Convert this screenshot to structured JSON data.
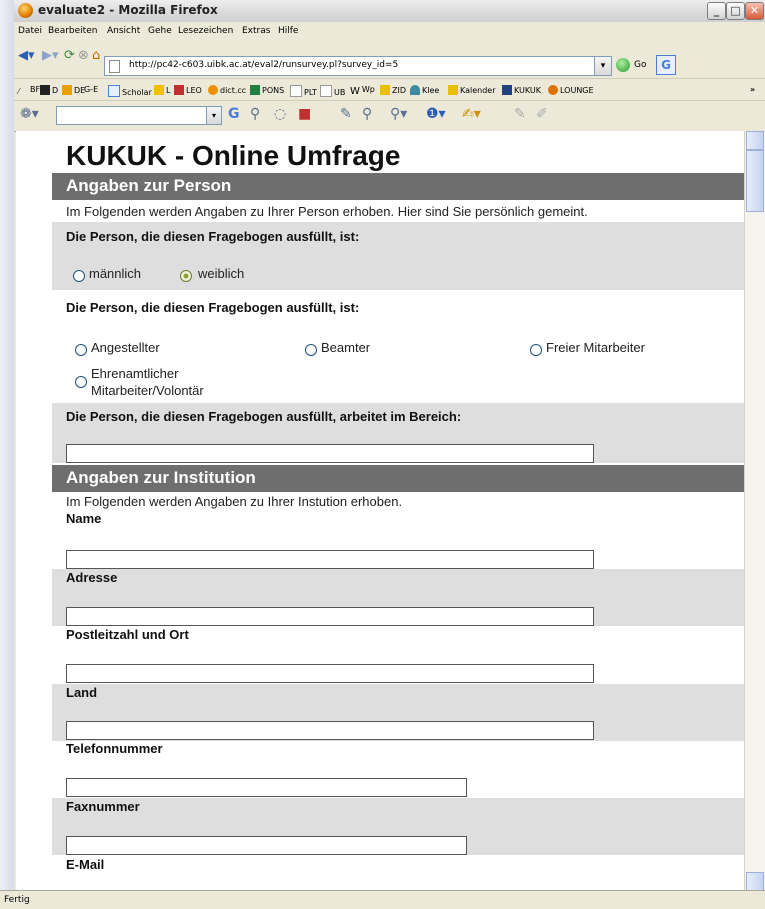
{
  "window": {
    "title": "evaluate2 - Mozilla Firefox"
  },
  "menu": [
    "Datei",
    "Bearbeiten",
    "Ansicht",
    "Gehe",
    "Lesezeichen",
    "Extras",
    "Hilfe"
  ],
  "nav": {
    "url": "http://pc42-c603.uibk.ac.at/eval2/runsurvey.pl?survey_id=5",
    "go_label": "Go"
  },
  "bookmarks": [
    "BF",
    "D",
    "DE",
    "G-E",
    "Scholar",
    "L",
    "LEO",
    "dict.cc",
    "PONS",
    "PLT",
    "UB",
    "Wp",
    "ZID",
    "Klee",
    "Kalender",
    "KUKUK",
    "LOUNGE"
  ],
  "status": "Fertig",
  "page": {
    "title": "KUKUK - Online Umfrage",
    "section1": {
      "heading": "Angaben zur Person",
      "intro": "Im Folgenden werden Angaben zu Ihrer Person erhoben. Hier sind Sie persönlich gemeint.",
      "q1": {
        "label": "Die Person, die diesen Fragebogen ausfüllt, ist:",
        "options": [
          "männlich",
          "weiblich"
        ],
        "selected": "weiblich"
      },
      "q2": {
        "label": "Die Person, die diesen Fragebogen ausfüllt, ist:",
        "options": [
          "Angestellter",
          "Beamter",
          "Freier Mitarbeiter",
          "Ehrenamtlicher",
          "Mitarbeiter/Volontär"
        ]
      },
      "q3": {
        "label": "Die Person, die diesen Fragebogen ausfüllt, arbeitet im Bereich:",
        "value": ""
      }
    },
    "section2": {
      "heading": "Angaben zur Institution",
      "intro": "Im Folgenden werden Angaben zu Ihrer Instution erhoben.",
      "fields": [
        {
          "label": "Name",
          "value": ""
        },
        {
          "label": "Adresse",
          "value": ""
        },
        {
          "label": "Postleitzahl und Ort",
          "value": ""
        },
        {
          "label": "Land",
          "value": ""
        },
        {
          "label": "Telefonnummer",
          "value": ""
        },
        {
          "label": "Faxnummer",
          "value": ""
        },
        {
          "label": "E-Mail",
          "value": ""
        }
      ]
    }
  }
}
